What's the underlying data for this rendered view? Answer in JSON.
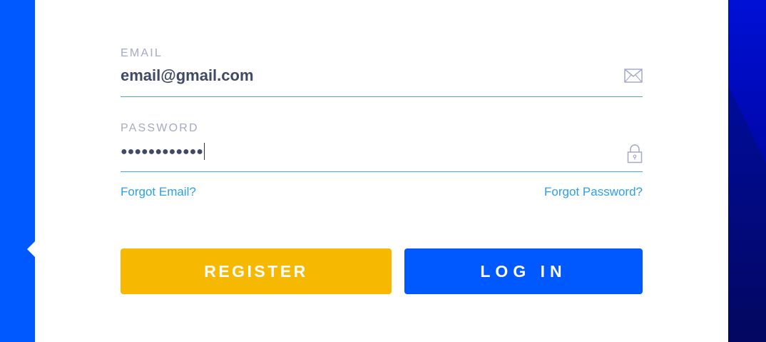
{
  "form": {
    "email": {
      "label": "EMAIL",
      "value": "email@gmail.com",
      "icon": "envelope-icon"
    },
    "password": {
      "label": "PASSWORD",
      "masked_value": "●●●●●●●●●●●●",
      "icon": "lock-icon"
    },
    "links": {
      "forgot_email": "Forgot Email?",
      "forgot_password": "Forgot Password?"
    },
    "buttons": {
      "register": "REGISTER",
      "login": "LOG IN"
    }
  },
  "colors": {
    "background_blue": "#0059ff",
    "card": "#ffffff",
    "register_button": "#f6b800",
    "login_button": "#0059ff",
    "link": "#2d9fe6",
    "field_underline": "#48a3d6",
    "label": "#a3aac7",
    "value_text": "#3f4a66"
  }
}
